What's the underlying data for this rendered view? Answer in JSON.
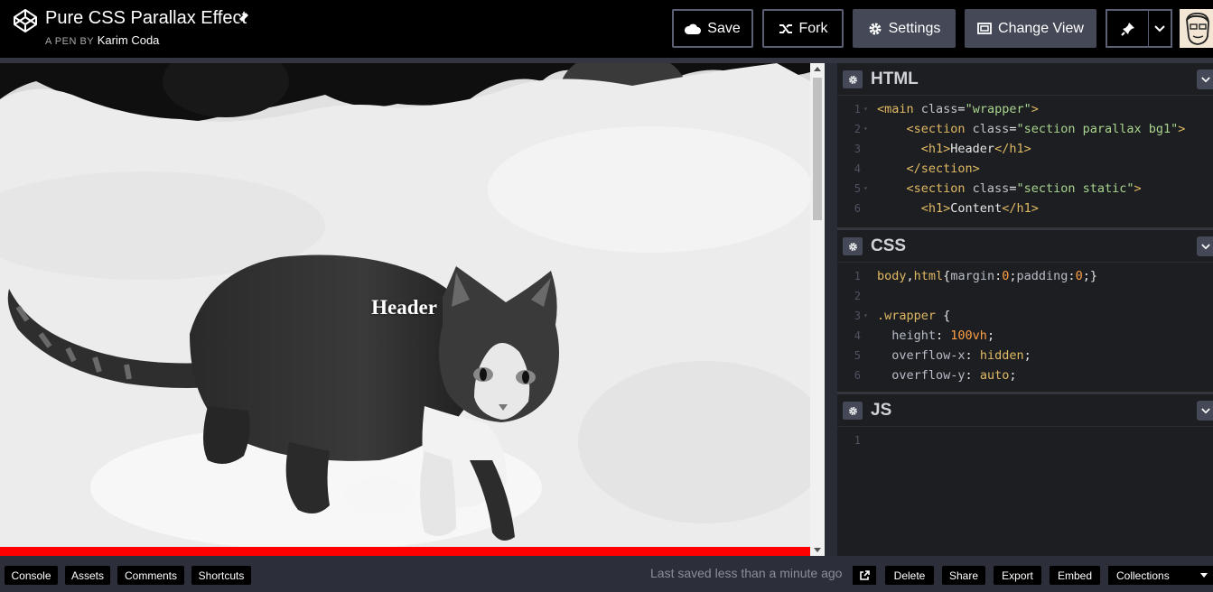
{
  "header": {
    "title": "Pure CSS Parallax Effect",
    "byline_prefix": "A PEN BY",
    "author": "Karim Coda",
    "buttons": {
      "save": "Save",
      "fork": "Fork",
      "settings": "Settings",
      "change_view": "Change View"
    }
  },
  "preview": {
    "heading": "Header"
  },
  "editors": {
    "html": {
      "title": "HTML",
      "lines": [
        {
          "n": "1",
          "fold": "▾",
          "parts": [
            [
              "tg",
              "<main "
            ],
            [
              "at",
              "class"
            ],
            [
              "vl",
              "="
            ],
            [
              "st",
              "\"wrapper\""
            ],
            [
              "tg",
              ">"
            ]
          ]
        },
        {
          "n": "2",
          "fold": "▾",
          "parts": [
            [
              "vl",
              "    "
            ],
            [
              "tg",
              "<section "
            ],
            [
              "at",
              "class"
            ],
            [
              "vl",
              "="
            ],
            [
              "st",
              "\"section parallax bg1\""
            ],
            [
              "tg",
              ">"
            ]
          ]
        },
        {
          "n": "3",
          "fold": "",
          "parts": [
            [
              "vl",
              "      "
            ],
            [
              "tg",
              "<h1>"
            ],
            [
              "vl",
              "Header"
            ],
            [
              "tg",
              "</h1>"
            ]
          ]
        },
        {
          "n": "4",
          "fold": "",
          "parts": [
            [
              "vl",
              "    "
            ],
            [
              "tg",
              "</section>"
            ]
          ]
        },
        {
          "n": "5",
          "fold": "▾",
          "parts": [
            [
              "vl",
              "    "
            ],
            [
              "tg",
              "<section "
            ],
            [
              "at",
              "class"
            ],
            [
              "vl",
              "="
            ],
            [
              "st",
              "\"section static\""
            ],
            [
              "tg",
              ">"
            ]
          ]
        },
        {
          "n": "6",
          "fold": "",
          "parts": [
            [
              "vl",
              "      "
            ],
            [
              "tg",
              "<h1>"
            ],
            [
              "vl",
              "Content"
            ],
            [
              "tg",
              "</h1>"
            ]
          ]
        }
      ]
    },
    "css": {
      "title": "CSS",
      "lines": [
        {
          "n": "1",
          "fold": "",
          "parts": [
            [
              "sel",
              "body"
            ],
            [
              "vl",
              ","
            ],
            [
              "sel",
              "html"
            ],
            [
              "vl",
              "{"
            ],
            [
              "pr",
              "margin"
            ],
            [
              "vl",
              ":"
            ],
            [
              "nu",
              "0"
            ],
            [
              "vl",
              ";"
            ],
            [
              "pr",
              "padding"
            ],
            [
              "vl",
              ":"
            ],
            [
              "nu",
              "0"
            ],
            [
              "vl",
              ";}"
            ]
          ]
        },
        {
          "n": "2",
          "fold": "",
          "parts": [
            [
              "vl",
              ""
            ]
          ]
        },
        {
          "n": "3",
          "fold": "▾",
          "parts": [
            [
              "sel",
              ".wrapper"
            ],
            [
              "vl",
              " {"
            ]
          ]
        },
        {
          "n": "4",
          "fold": "",
          "parts": [
            [
              "pr",
              "  height"
            ],
            [
              "vl",
              ": "
            ],
            [
              "nu",
              "100vh"
            ],
            [
              "vl",
              ";"
            ]
          ]
        },
        {
          "n": "5",
          "fold": "",
          "parts": [
            [
              "pr",
              "  overflow-x"
            ],
            [
              "vl",
              ": "
            ],
            [
              "sel",
              "hidden"
            ],
            [
              "vl",
              ";"
            ]
          ]
        },
        {
          "n": "6",
          "fold": "",
          "parts": [
            [
              "pr",
              "  overflow-y"
            ],
            [
              "vl",
              ": "
            ],
            [
              "sel",
              "auto"
            ],
            [
              "vl",
              ";"
            ]
          ]
        }
      ]
    },
    "js": {
      "title": "JS",
      "lines": [
        {
          "n": "1",
          "fold": "",
          "parts": [
            [
              "vl",
              ""
            ]
          ]
        }
      ]
    }
  },
  "footer": {
    "console": "Console",
    "assets": "Assets",
    "comments": "Comments",
    "shortcuts": "Shortcuts",
    "saved_status": "Last saved less than a minute ago",
    "delete": "Delete",
    "share": "Share",
    "export": "Export",
    "embed": "Embed",
    "collections": "Collections"
  },
  "icons": {
    "logo": "codepen-logo-icon",
    "edit": "pencil-icon",
    "save": "cloud-icon",
    "fork": "fork-icon",
    "settings": "gear-icon",
    "change_view": "layout-icon",
    "pin": "pin-icon",
    "external": "external-link-icon"
  },
  "colors": {
    "accent_red": "#ff0000",
    "button_dark": "#444857",
    "footer_bg": "#2c2f3a"
  }
}
